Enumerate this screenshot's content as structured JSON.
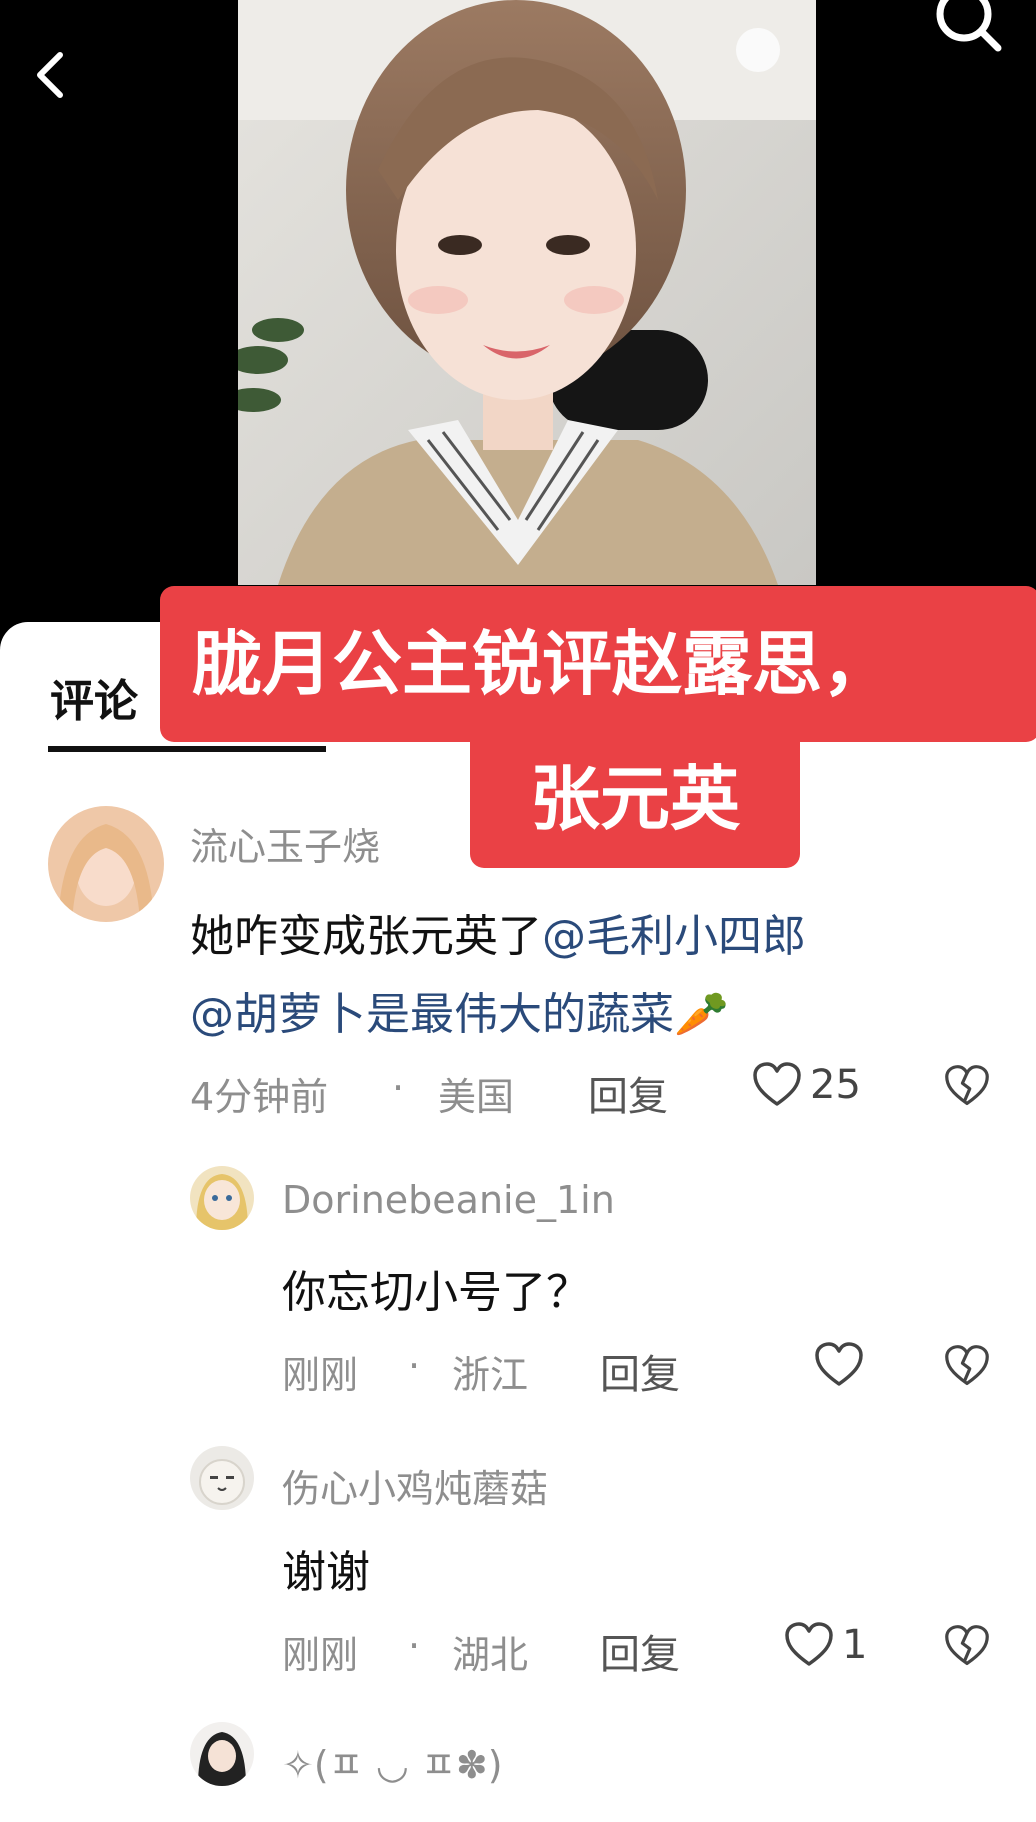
{
  "tab": {
    "label": "评论"
  },
  "overlay": {
    "line1": "胧月公主锐评赵露思，",
    "line2": "张元英"
  },
  "comments": [
    {
      "username": "流心玉子烧",
      "text": "她咋变成张元英了",
      "mention1": "@毛利小四郎",
      "mention2": "@胡萝卜是最伟大的蔬菜",
      "emoji": "🥕",
      "time": "4分钟前",
      "dot": "·",
      "location": "美国",
      "reply": "回复",
      "likes": "25"
    },
    {
      "username": "Dorinebeanie_1in",
      "text": "你忘切小号了？",
      "time": "刚刚",
      "dot": "·",
      "location": "浙江",
      "reply": "回复",
      "likes": ""
    },
    {
      "username": "伤心小鸡炖蘑菇",
      "text": "谢谢",
      "time": "刚刚",
      "dot": "·",
      "location": "湖北",
      "reply": "回复",
      "likes": "1"
    },
    {
      "username": "✧(ㅍ ◡ ㅍ✽)"
    }
  ],
  "colors": {
    "accent": "#ea4145",
    "mention": "#2a4a7a",
    "meta": "#8e8e8e"
  },
  "icons": [
    "back-icon",
    "search-icon",
    "heart-icon",
    "broken-heart-icon"
  ]
}
